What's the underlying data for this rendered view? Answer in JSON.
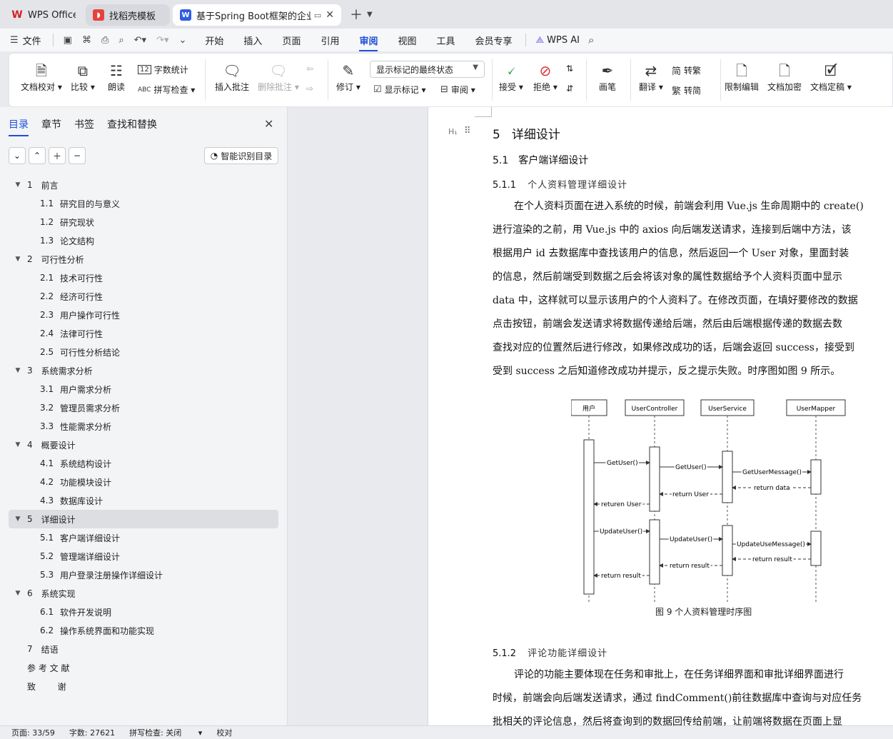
{
  "tabs": [
    {
      "label": "WPS Office",
      "icon": "wps-logo-icon"
    },
    {
      "label": "找稻壳模板",
      "icon": "docer-icon"
    },
    {
      "label": "基于Spring Boot框架的企业项",
      "icon": "writer-doc-icon",
      "close": "✕"
    }
  ],
  "menubar": {
    "file": "文件",
    "items": [
      "开始",
      "插入",
      "页面",
      "引用",
      "审阅",
      "视图",
      "工具",
      "会员专享"
    ],
    "active": "审阅",
    "ai": "WPS AI"
  },
  "ribbon": {
    "doc_proofread": "文档校对",
    "compare": "比较",
    "read_aloud": "朗读",
    "word_count": "字数统计",
    "spell_check": "拼写检查",
    "insert_comment": "插入批注",
    "delete_comment": "删除批注",
    "revise": "修订",
    "markup_state": "显示标记的最终状态",
    "show_markup": "显示标记",
    "review": "审阅",
    "accept": "接受",
    "reject": "拒绝",
    "pen": "画笔",
    "translate": "翻译",
    "to_traditional": "转繁",
    "to_simplified": "转简",
    "restrict_edit": "限制编辑",
    "encrypt": "文档加密",
    "finalize": "文档定稿"
  },
  "nav": {
    "tabs": [
      "目录",
      "章节",
      "书签",
      "查找和替换"
    ],
    "smart_toc": "智能识别目录",
    "toc": [
      {
        "level": 1,
        "num": "1",
        "title": "前言"
      },
      {
        "level": 2,
        "num": "1.1",
        "title": "研究目的与意义"
      },
      {
        "level": 2,
        "num": "1.2",
        "title": "研究现状"
      },
      {
        "level": 2,
        "num": "1.3",
        "title": "论文结构"
      },
      {
        "level": 1,
        "num": "2",
        "title": "可行性分析"
      },
      {
        "level": 2,
        "num": "2.1",
        "title": "技术可行性"
      },
      {
        "level": 2,
        "num": "2.2",
        "title": "经济可行性"
      },
      {
        "level": 2,
        "num": "2.3",
        "title": "用户操作可行性"
      },
      {
        "level": 2,
        "num": "2.4",
        "title": "法律可行性"
      },
      {
        "level": 2,
        "num": "2.5",
        "title": "可行性分析结论"
      },
      {
        "level": 1,
        "num": "3",
        "title": "系统需求分析"
      },
      {
        "level": 2,
        "num": "3.1",
        "title": "用户需求分析"
      },
      {
        "level": 2,
        "num": "3.2",
        "title": "管理员需求分析"
      },
      {
        "level": 2,
        "num": "3.3",
        "title": "性能需求分析"
      },
      {
        "level": 1,
        "num": "4",
        "title": "概要设计"
      },
      {
        "level": 2,
        "num": "4.1",
        "title": "系统结构设计"
      },
      {
        "level": 2,
        "num": "4.2",
        "title": "功能模块设计"
      },
      {
        "level": 2,
        "num": "4.3",
        "title": "数据库设计"
      },
      {
        "level": 1,
        "num": "5",
        "title": "详细设计",
        "selected": true
      },
      {
        "level": 2,
        "num": "5.1",
        "title": "客户端详细设计"
      },
      {
        "level": 2,
        "num": "5.2",
        "title": "管理端详细设计"
      },
      {
        "level": 2,
        "num": "5.3",
        "title": "用户登录注册操作详细设计"
      },
      {
        "level": 1,
        "num": "6",
        "title": "系统实现"
      },
      {
        "level": 2,
        "num": "6.1",
        "title": "软件开发说明"
      },
      {
        "level": 2,
        "num": "6.2",
        "title": "操作系统界面和功能实现"
      },
      {
        "level": 0,
        "num": "7",
        "title": "结语"
      },
      {
        "level": 0,
        "num": "",
        "title": "参 考 文 献"
      },
      {
        "level": 0,
        "num": "",
        "title": "致        谢"
      }
    ]
  },
  "document": {
    "h1": {
      "num": "5",
      "title": "详细设计"
    },
    "h2": {
      "num": "5.1",
      "title": "客户端详细设计"
    },
    "h3a": {
      "num": "5.1.1",
      "title": "个人资料管理详细设计"
    },
    "para1": [
      "在个人资料页面在进入系统的时候，前端会利用 Vue.js 生命周期中的 create()",
      "进行渲染的之前，用 Vue.js 中的 axios 向后端发送请求，连接到后端中方法，该",
      "根据用户 id 去数据库中查找该用户的信息，然后返回一个 User 对象，里面封装",
      "的信息，然后前端受到数据之后会将该对象的属性数据给予个人资料页面中显示",
      "data 中，这样就可以显示该用户的个人资料了。在修改页面，在填好要修改的数据",
      "点击按钮，前端会发送请求将数据传递给后端，然后由后端根据传递的数据去数",
      "查找对应的位置然后进行修改，如果修改成功的话，后端会返回 success，接受到",
      "受到 success 之后知道修改成功并提示，反之提示失败。时序图如图 9 所示。"
    ],
    "figure": {
      "caption": "图 9  个人资料管理时序图",
      "lifelines": [
        "用户",
        "UserController",
        "UserService",
        "UserMapper"
      ],
      "messages": [
        "GetUser()",
        "GetUser()",
        "GetUserMessage()",
        "return data",
        "return User",
        "returen User",
        "UpdateUser()",
        "UpdateUser()",
        "UpdateUseMessage()",
        "return result",
        "return result",
        "return result"
      ]
    },
    "h3b": {
      "num": "5.1.2",
      "title": "评论功能详细设计"
    },
    "para2": [
      "评论的功能主要体现在任务和审批上，在任务详细界面和审批详细界面进行",
      "时候，前端会向后端发送请求，通过 findComment()前往数据库中查询与对应任务",
      "批相关的评论信息，然后将查询到的数据回传给前端，让前端将数据在页面上显"
    ]
  },
  "status": {
    "page": "页面: 33/59",
    "words": "字数: 27621",
    "spell": "拼写检查: 关闭",
    "proof": "校对"
  }
}
